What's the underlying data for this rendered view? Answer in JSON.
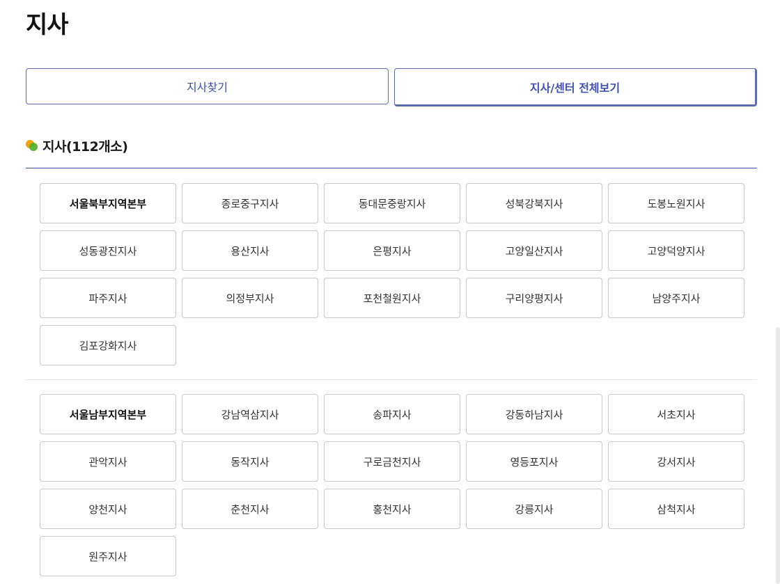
{
  "page": {
    "title": "지사"
  },
  "tabs": [
    {
      "label": "지사찾기"
    },
    {
      "label": "지사/센터 전체보기"
    }
  ],
  "section": {
    "label": "지사(112개소)"
  },
  "groups": [
    {
      "items": [
        "서울북부지역본부",
        "종로중구지사",
        "동대문중랑지사",
        "성북강북지사",
        "도봉노원지사",
        "성동광진지사",
        "용산지사",
        "은평지사",
        "고양일산지사",
        "고양덕양지사",
        "파주지사",
        "의정부지사",
        "포천철원지사",
        "구리양평지사",
        "남양주지사",
        "김포강화지사"
      ]
    },
    {
      "items": [
        "서울남부지역본부",
        "강남역삼지사",
        "송파지사",
        "강동하남지사",
        "서초지사",
        "관악지사",
        "동작지사",
        "구로금천지사",
        "영등포지사",
        "강서지사",
        "양천지사",
        "춘천지사",
        "홍천지사",
        "강릉지사",
        "삼척지사",
        "원주지사"
      ]
    }
  ],
  "colors": {
    "accent": "#3f51b5",
    "dot_orange": "#f5a300",
    "dot_green": "#4caf28"
  }
}
